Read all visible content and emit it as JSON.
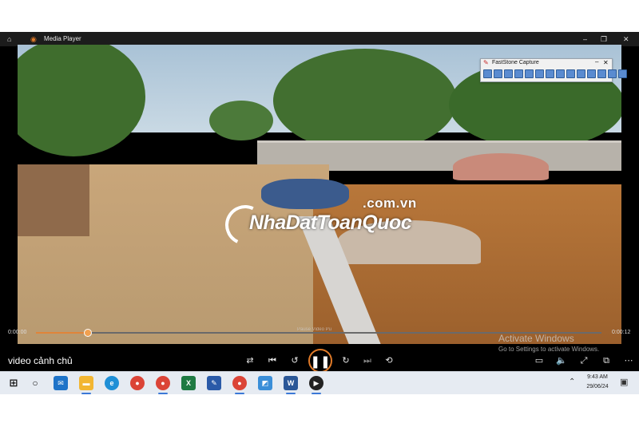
{
  "window": {
    "title": "Media Player"
  },
  "video": {
    "watermark_domain": ".com.vn",
    "watermark_brand": "NhaDatToanQuoc"
  },
  "faststone": {
    "title": "FastStone Capture"
  },
  "controls": {
    "current_time": "0:00:00",
    "total_time": "0:00:12",
    "seek_hint": "Pause Video Pu",
    "progress_percent": 9,
    "video_title": "video cảnh chủ"
  },
  "activation": {
    "line1": "Activate Windows",
    "line2": "Go to Settings to activate Windows."
  },
  "taskbar": {
    "time": "9:43 AM",
    "date": "29/06/24",
    "apps": [
      "start-icon",
      "search-icon",
      "mail-icon",
      "file-explorer-icon",
      "edge-icon",
      "chrome-icon",
      "chrome-icon",
      "excel-icon",
      "app-icon",
      "chrome-icon",
      "app-icon",
      "word-icon",
      "media-player-icon"
    ]
  },
  "colors": {
    "accent": "#e07a28",
    "taskbar": "#e6ebf2"
  }
}
